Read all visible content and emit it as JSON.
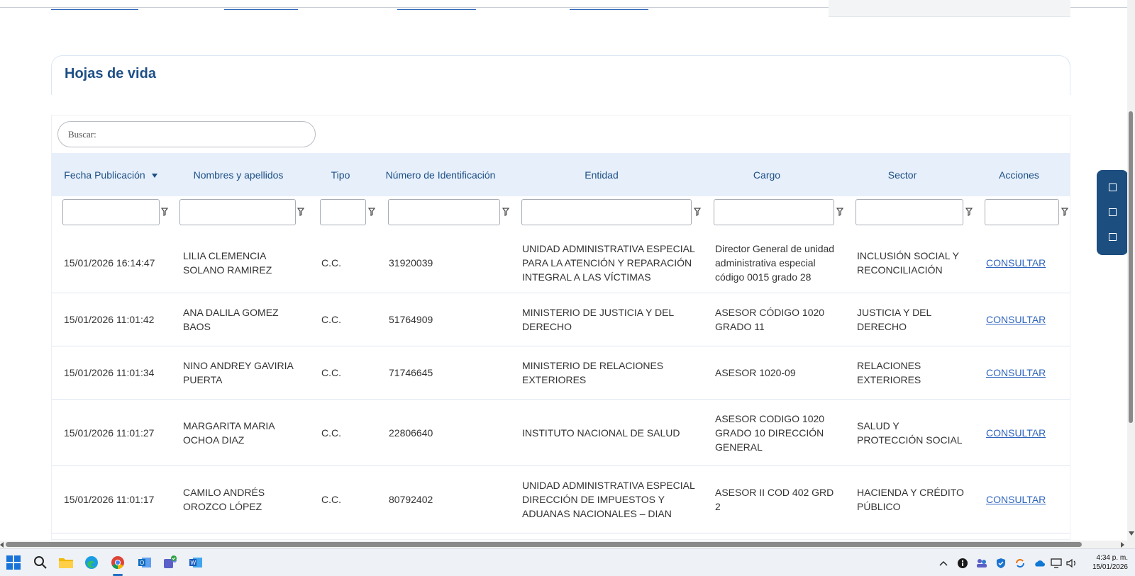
{
  "page": {
    "title": "Hojas de vida"
  },
  "search": {
    "placeholder": "Buscar:"
  },
  "columns": [
    {
      "label": "Fecha Publicación"
    },
    {
      "label": "Nombres y apellidos"
    },
    {
      "label": "Tipo"
    },
    {
      "label": "Número de Identificación"
    },
    {
      "label": "Entidad"
    },
    {
      "label": "Cargo"
    },
    {
      "label": "Sector"
    },
    {
      "label": "Acciones"
    }
  ],
  "rows": [
    {
      "fecha": "15/01/2026 16:14:47",
      "nombres": [
        "LILIA CLEMENCIA",
        "SOLANO RAMIREZ"
      ],
      "tipo": "C.C.",
      "numero": "31920039",
      "entidad": [
        "UNIDAD ADMINISTRATIVA ESPECIAL",
        "PARA LA ATENCIÓN Y REPARACIÓN",
        "INTEGRAL A LAS VÍCTIMAS"
      ],
      "cargo": [
        "Director General de unidad",
        "administrativa especial",
        "código 0015 grado 28"
      ],
      "sector": [
        "INCLUSIÓN SOCIAL Y",
        "RECONCILIACIÓN"
      ],
      "accion": "CONSULTAR"
    },
    {
      "fecha": "15/01/2026 11:01:42",
      "nombres": [
        "ANA DALILA GOMEZ",
        "BAOS"
      ],
      "tipo": "C.C.",
      "numero": "51764909",
      "entidad": [
        "MINISTERIO DE JUSTICIA Y DEL",
        "DERECHO"
      ],
      "cargo": [
        "ASESOR CÓDIGO 1020",
        "GRADO 11"
      ],
      "sector": [
        "JUSTICIA Y DEL",
        "DERECHO"
      ],
      "accion": "CONSULTAR"
    },
    {
      "fecha": "15/01/2026 11:01:34",
      "nombres": [
        "NINO ANDREY GAVIRIA",
        "PUERTA"
      ],
      "tipo": "C.C.",
      "numero": "71746645",
      "entidad": [
        "MINISTERIO DE RELACIONES",
        "EXTERIORES"
      ],
      "cargo": [
        "ASESOR 1020-09"
      ],
      "sector": [
        "RELACIONES",
        "EXTERIORES"
      ],
      "accion": "CONSULTAR"
    },
    {
      "fecha": "15/01/2026 11:01:27",
      "nombres": [
        "MARGARITA MARIA",
        "OCHOA DIAZ"
      ],
      "tipo": "C.C.",
      "numero": "22806640",
      "entidad": [
        "INSTITUTO NACIONAL DE SALUD"
      ],
      "cargo": [
        "ASESOR CODIGO 1020",
        "GRADO 10 DIRECCIÓN",
        "GENERAL"
      ],
      "sector": [
        "SALUD Y",
        "PROTECCIÓN SOCIAL"
      ],
      "accion": "CONSULTAR"
    },
    {
      "fecha": "15/01/2026 11:01:17",
      "nombres": [
        "CAMILO ANDRÉS",
        "OROZCO LÓPEZ"
      ],
      "tipo": "C.C.",
      "numero": "80792402",
      "entidad": [
        "UNIDAD ADMINISTRATIVA ESPECIAL",
        "DIRECCIÓN DE IMPUESTOS Y",
        "ADUANAS NACIONALES – DIAN"
      ],
      "cargo": [
        "ASESOR II COD 402 GRD",
        "2"
      ],
      "sector": [
        "HACIENDA Y CRÉDITO",
        "PÚBLICO"
      ],
      "accion": "CONSULTAR"
    }
  ],
  "taskbar": {
    "time": "4:34 p. m.",
    "date": "15/01/2026",
    "icons": [
      "windows-start-icon",
      "search-icon",
      "file-explorer-icon",
      "edge-icon",
      "chrome-icon",
      "outlook-icon",
      "teams-icon",
      "word-icon"
    ]
  },
  "colors": {
    "heading": "#1d4f86",
    "header_bg": "#e6effa",
    "link": "#2e64bd",
    "widget": "#1c4e80"
  }
}
